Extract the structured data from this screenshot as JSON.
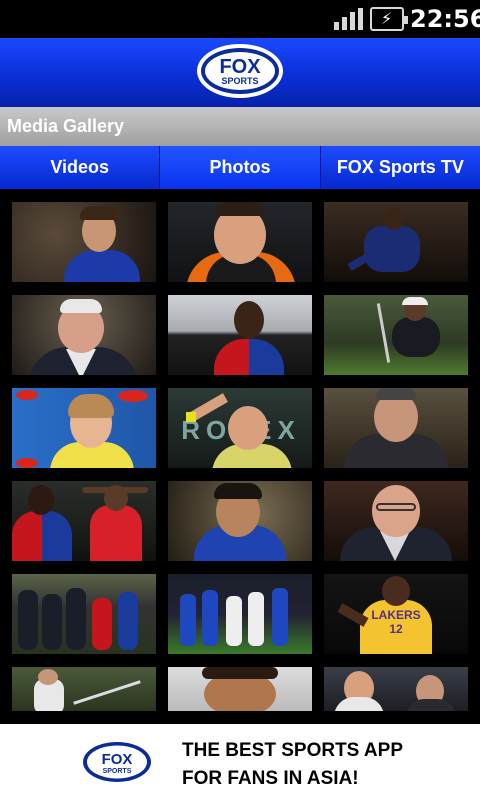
{
  "status_bar": {
    "time": "22:56",
    "icons": [
      "signal-icon",
      "battery-charging-icon"
    ]
  },
  "header": {
    "logo_top": "FOX",
    "logo_bottom": "SPORTS"
  },
  "section": {
    "title": "Media Gallery"
  },
  "tabs": [
    {
      "label": "Videos"
    },
    {
      "label": "Photos",
      "active": true
    },
    {
      "label": "FOX Sports TV"
    }
  ],
  "thumbnails": [
    {
      "name": "player-blue-kit"
    },
    {
      "name": "manager-smiling"
    },
    {
      "name": "player-dark-kit"
    },
    {
      "name": "manager-suit"
    },
    {
      "name": "player-red-blue-kit"
    },
    {
      "name": "golfer-crouching"
    },
    {
      "name": "tennis-player-press"
    },
    {
      "name": "tennis-player-pointing"
    },
    {
      "name": "manager-coat"
    },
    {
      "name": "players-celebrating"
    },
    {
      "name": "player-blue-kit-2"
    },
    {
      "name": "coach-glasses"
    },
    {
      "name": "team-huddle"
    },
    {
      "name": "teams-on-pitch"
    },
    {
      "name": "basketball-player",
      "text": "LAKERS 12"
    },
    {
      "name": "golfer-swing"
    },
    {
      "name": "player-closeup"
    },
    {
      "name": "tennis-players"
    }
  ],
  "banner": {
    "logo_top": "FOX",
    "logo_bottom": "SPORTS",
    "line1": "THE BEST SPORTS APP",
    "line2": "FOR FANS IN ASIA!"
  },
  "colors": {
    "header_blue": "#0b2fd8",
    "tab_blue": "#0a2be0",
    "section_gray": "#b5b5b5"
  }
}
